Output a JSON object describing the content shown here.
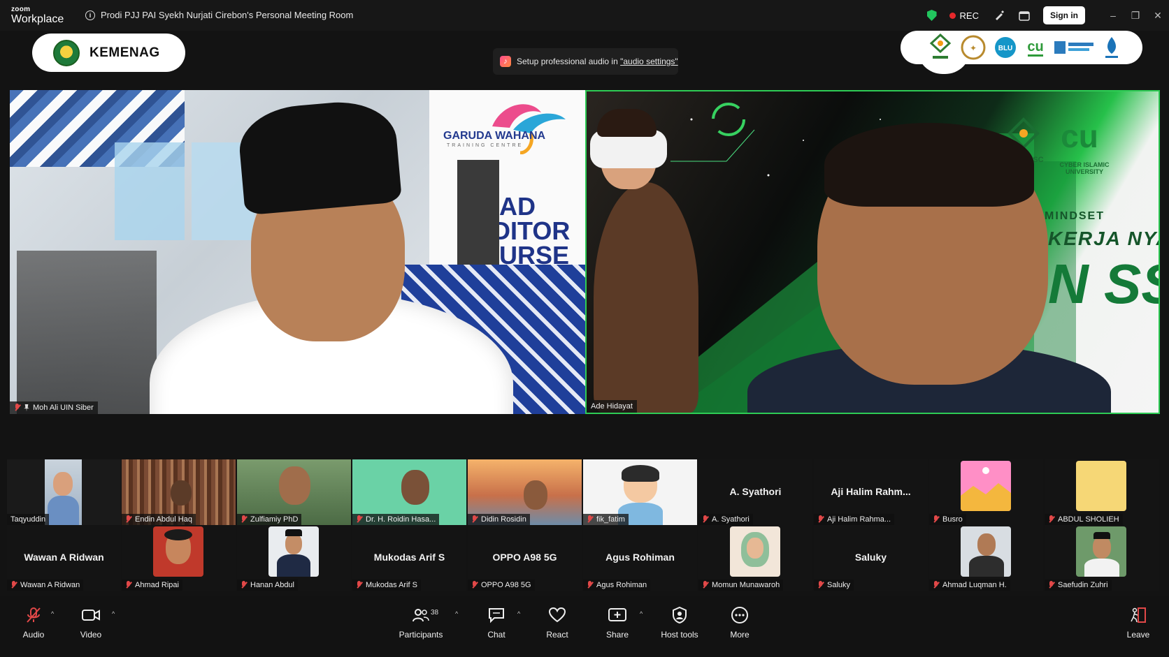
{
  "titlebar": {
    "brand_top": "zoom",
    "brand_bottom": "Workplace",
    "meeting_title": "Prodi PJJ PAI Syekh Nurjati Cirebon's Personal Meeting Room",
    "rec_label": "REC",
    "sign_in_label": "Sign in",
    "accent_security": "#22c55e",
    "rec_color": "#e5282b"
  },
  "overlays": {
    "kemenag_label": "KEMENAG",
    "audio_tip_prefix": "Setup professional audio in ",
    "audio_tip_link": "\"audio settings\"",
    "partner_logos": [
      "UINSSC",
      "BLU",
      "CU",
      "Kemenag Berdampak",
      "pusaka"
    ]
  },
  "main_tiles": [
    {
      "name": "Moh Ali UIN Siber",
      "slide_brand": "GARUDA WAHANA",
      "slide_brand_sub": "TRAINING CENTRE",
      "slide_lines": [
        "AD",
        "DITOR",
        "URSE"
      ]
    },
    {
      "name": "Ade Hidayat",
      "slide_logo_1": "UINSSC",
      "slide_logo_2": "CYBER ISLAMIC UNIVERSITY",
      "slide_lines": [
        "MINDSET",
        "KERJA NYA",
        "N SS"
      ],
      "active_speaker_color": "#2ecc55"
    }
  ],
  "gallery": {
    "row1": [
      {
        "name": "Taqyuddin",
        "center_name": ""
      },
      {
        "name": "Endin Abdul Haq",
        "center_name": ""
      },
      {
        "name": "Zulfiamiy PhD",
        "center_name": ""
      },
      {
        "name": "Dr. H. Roidin Hasa...",
        "center_name": ""
      },
      {
        "name": "Didin Rosidin",
        "center_name": ""
      },
      {
        "name": "fik_fatim",
        "center_name": ""
      },
      {
        "name": "A. Syathori",
        "center_name": "A. Syathori"
      },
      {
        "name": "Aji Halim Rahma...",
        "center_name": "Aji Halim Rahm..."
      },
      {
        "name": "Busro",
        "center_name": ""
      },
      {
        "name": "ABDUL SHOLIEH",
        "center_name": ""
      }
    ],
    "row2": [
      {
        "name": "Wawan A Ridwan",
        "center_name": "Wawan A Ridwan"
      },
      {
        "name": "Ahmad Ripai",
        "center_name": ""
      },
      {
        "name": "Hanan Abdul",
        "center_name": ""
      },
      {
        "name": "Mukodas Arif S",
        "center_name": "Mukodas Arif S"
      },
      {
        "name": "OPPO A98 5G",
        "center_name": "OPPO A98 5G"
      },
      {
        "name": "Agus Rohiman",
        "center_name": "Agus Rohiman"
      },
      {
        "name": "Momun Munawaroh",
        "center_name": ""
      },
      {
        "name": "Saluky",
        "center_name": "Saluky"
      },
      {
        "name": "Ahmad Luqman H.",
        "center_name": ""
      },
      {
        "name": "Saefudin Zuhri",
        "center_name": ""
      }
    ]
  },
  "toolbar": {
    "audio": "Audio",
    "video": "Video",
    "participants": "Participants",
    "participants_count": "38",
    "chat": "Chat",
    "react": "React",
    "share": "Share",
    "host_tools": "Host tools",
    "more": "More",
    "leave": "Leave"
  }
}
